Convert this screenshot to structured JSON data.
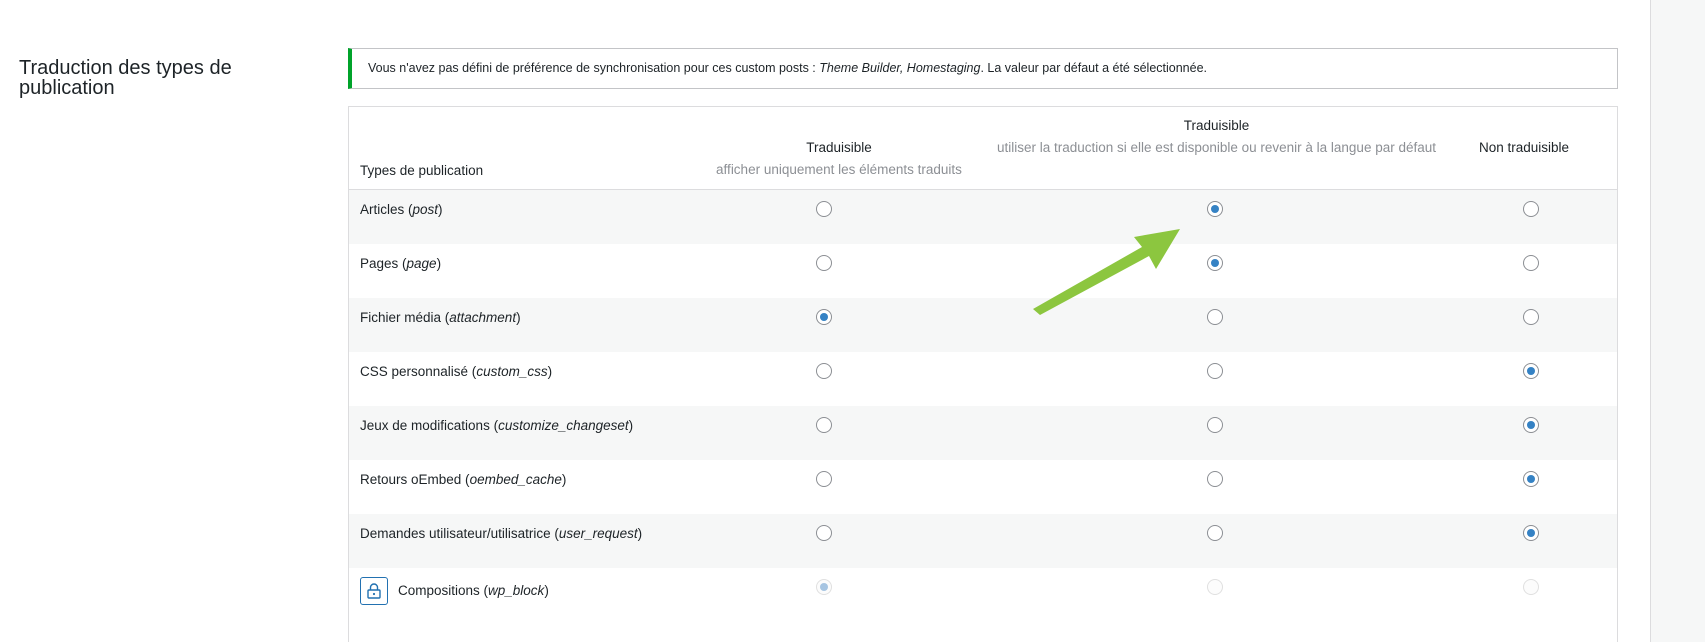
{
  "section": {
    "title": "Traduction des types de publication"
  },
  "notice": {
    "text_before": "Vous n'avez pas défini de préférence de synchronisation pour ces custom posts : ",
    "emphasis": "Theme Builder, Homestaging",
    "text_after": ". La valeur par défaut a été sélectionnée.",
    "accent_color": "#00a32a"
  },
  "table": {
    "header": {
      "types": "Types de publication",
      "col1_label": "Traduisible",
      "col1_sub": "afficher uniquement les éléments traduits",
      "col2_label": "Traduisible",
      "col2_sub": "utiliser la traduction si elle est disponible ou revenir à la langue par défaut",
      "col3_label": "Non traduisible"
    },
    "rows": [
      {
        "name": "Articles",
        "slug": "post",
        "selected": 2,
        "locked": false
      },
      {
        "name": "Pages",
        "slug": "page",
        "selected": 2,
        "locked": false
      },
      {
        "name": "Fichier média",
        "slug": "attachment",
        "selected": 1,
        "locked": false
      },
      {
        "name": "CSS personnalisé",
        "slug": "custom_css",
        "selected": 3,
        "locked": false
      },
      {
        "name": "Jeux de modifications",
        "slug": "customize_changeset",
        "selected": 3,
        "locked": false
      },
      {
        "name": "Retours oEmbed",
        "slug": "oembed_cache",
        "selected": 3,
        "locked": false
      },
      {
        "name": "Demandes utilisateur/utilisatrice",
        "slug": "user_request",
        "selected": 3,
        "locked": false
      },
      {
        "name": "Compositions",
        "slug": "wp_block",
        "selected": 1,
        "locked": true
      }
    ]
  },
  "annotation": {
    "arrow_color": "#8cc63f"
  },
  "colors": {
    "radio_checked": "#3582c4",
    "row_alt": "#f6f7f7"
  }
}
